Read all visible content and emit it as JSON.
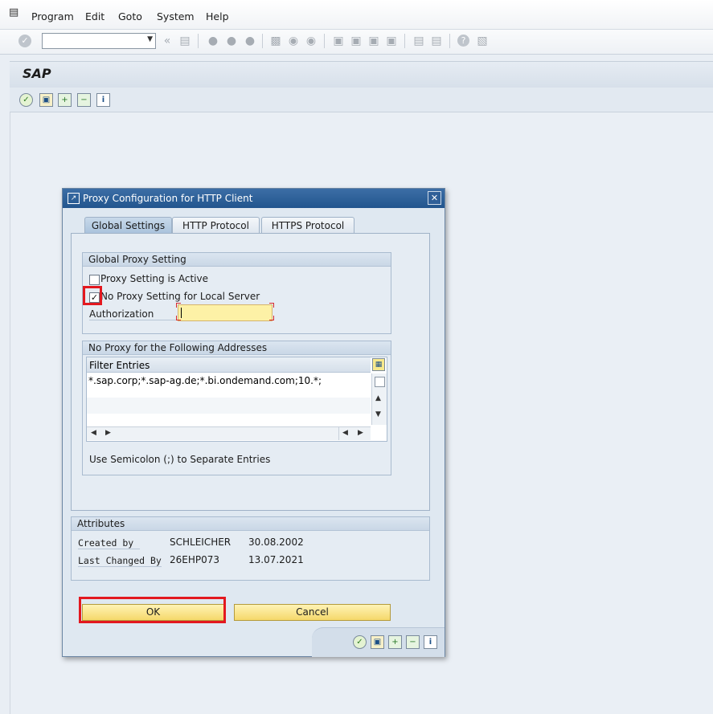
{
  "menubar": {
    "items": [
      {
        "label": "Program"
      },
      {
        "label": "Edit"
      },
      {
        "label": "Goto"
      },
      {
        "label": "System"
      },
      {
        "label": "Help"
      }
    ]
  },
  "toolbar": {
    "command_field_value": ""
  },
  "app": {
    "title": "SAP"
  },
  "dialog": {
    "title": "Proxy Configuration for HTTP Client",
    "tabs": [
      {
        "label": "Global Settings",
        "active": true
      },
      {
        "label": "HTTP Protocol",
        "active": false
      },
      {
        "label": "HTTPS Protocol",
        "active": false
      }
    ],
    "global_proxy": {
      "heading": "Global Proxy Setting",
      "proxy_active_label": "Proxy Setting is Active",
      "proxy_active_checked": false,
      "no_proxy_local_label": "No Proxy Setting for Local Server",
      "no_proxy_local_checked": true,
      "authorization_label": "Authorization",
      "authorization_value": ""
    },
    "no_proxy": {
      "heading": "No Proxy for the Following Addresses",
      "table_header": "Filter Entries",
      "entries": [
        "*.sap.corp;*.sap-ag.de;*.bi.ondemand.com;10.*;"
      ],
      "hint": "Use Semicolon (;) to Separate Entries"
    },
    "attributes": {
      "heading": "Attributes",
      "rows": [
        {
          "label": "Created by",
          "user": "SCHLEICHER",
          "date": "30.08.2002"
        },
        {
          "label": "Last Changed By",
          "user": "26EHP073",
          "date": "13.07.2021"
        }
      ]
    },
    "ok_label": "OK",
    "cancel_label": "Cancel"
  },
  "colors": {
    "highlight_red": "#e3181f",
    "dialog_title_blue": "#2a5c94",
    "button_yellow": "#f5d86a"
  }
}
